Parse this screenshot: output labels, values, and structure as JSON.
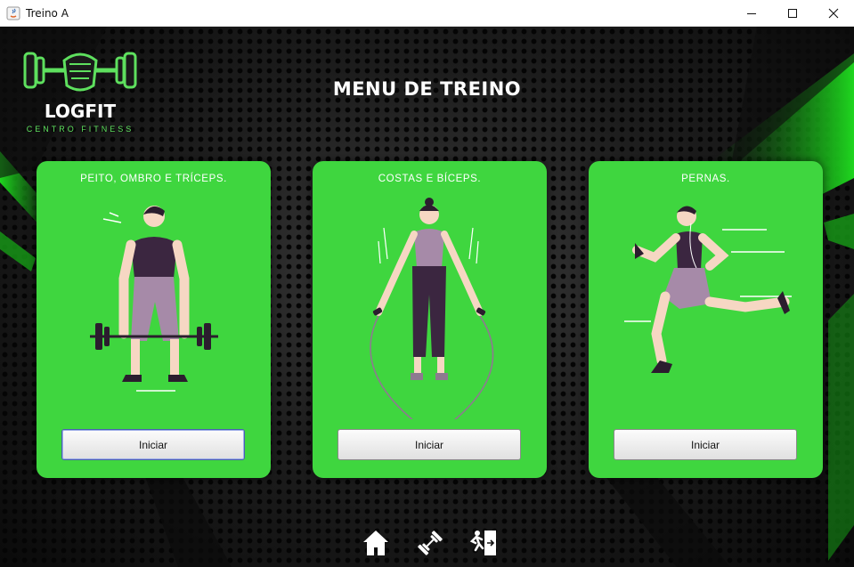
{
  "window": {
    "title": "Treino A",
    "buttons": [
      "minimize",
      "maximize",
      "close"
    ]
  },
  "logo": {
    "name": "LOGFIT",
    "tagline": "CENTRO FITNESS"
  },
  "header": {
    "title": "MENU DE TREINO"
  },
  "cards": [
    {
      "title": "PEITO, OMBRO E TRÍCEPS.",
      "button_label": "Iniciar",
      "illustration": "deadlift-icon"
    },
    {
      "title": "COSTAS E BÍCEPS.",
      "button_label": "Iniciar",
      "illustration": "jump-rope-icon"
    },
    {
      "title": "PERNAS.",
      "button_label": "Iniciar",
      "illustration": "running-icon"
    }
  ],
  "nav": [
    "home-icon",
    "dumbbell-icon",
    "exit-icon"
  ],
  "colors": {
    "card_green": "#3fd63f",
    "accent_green": "#2ee82e",
    "background": "#151515"
  }
}
